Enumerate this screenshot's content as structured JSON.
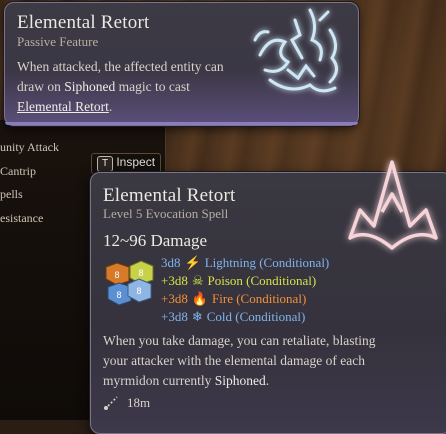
{
  "background_list": [
    "unity Attack",
    "Cantrip",
    "pells",
    "esistance"
  ],
  "inspect": {
    "key": "T",
    "label": "Inspect"
  },
  "feature": {
    "title": "Elemental Retort",
    "subtitle": "Passive Feature",
    "desc_part1": "When attacked, the affected entity can draw on ",
    "desc_hl": "Siphoned",
    "desc_part2": " magic to cast",
    "desc_link": "Elemental Retort",
    "desc_end": ".",
    "icon": "elemental-rune-icon"
  },
  "spell": {
    "title": "Elemental Retort",
    "subtitle": "Level 5 Evocation Spell",
    "damage_title": "12~96 Damage",
    "damage_rows": [
      {
        "prefix": "3d8",
        "type": "Lightning (Conditional)",
        "icon": "lightning-icon",
        "color": "#7fb4ec"
      },
      {
        "prefix": "+3d8",
        "type": "Poison (Conditional)",
        "icon": "poison-icon",
        "color": "#d6e24a"
      },
      {
        "prefix": "+3d8",
        "type": "Fire (Conditional)",
        "icon": "fire-icon",
        "color": "#f2913a"
      },
      {
        "prefix": "+3d8",
        "type": "Cold (Conditional)",
        "icon": "cold-icon",
        "color": "#7fb4ec"
      }
    ],
    "dice_labels": [
      "8",
      "8",
      "8",
      "8"
    ],
    "desc_part1": "When you take damage, you can retaliate, blasting your attacker with the elemental damage of each myrmidon currently ",
    "desc_hl": "Siphoned",
    "desc_end": ".",
    "range": "18m",
    "icon": "spell-crown-icon"
  }
}
